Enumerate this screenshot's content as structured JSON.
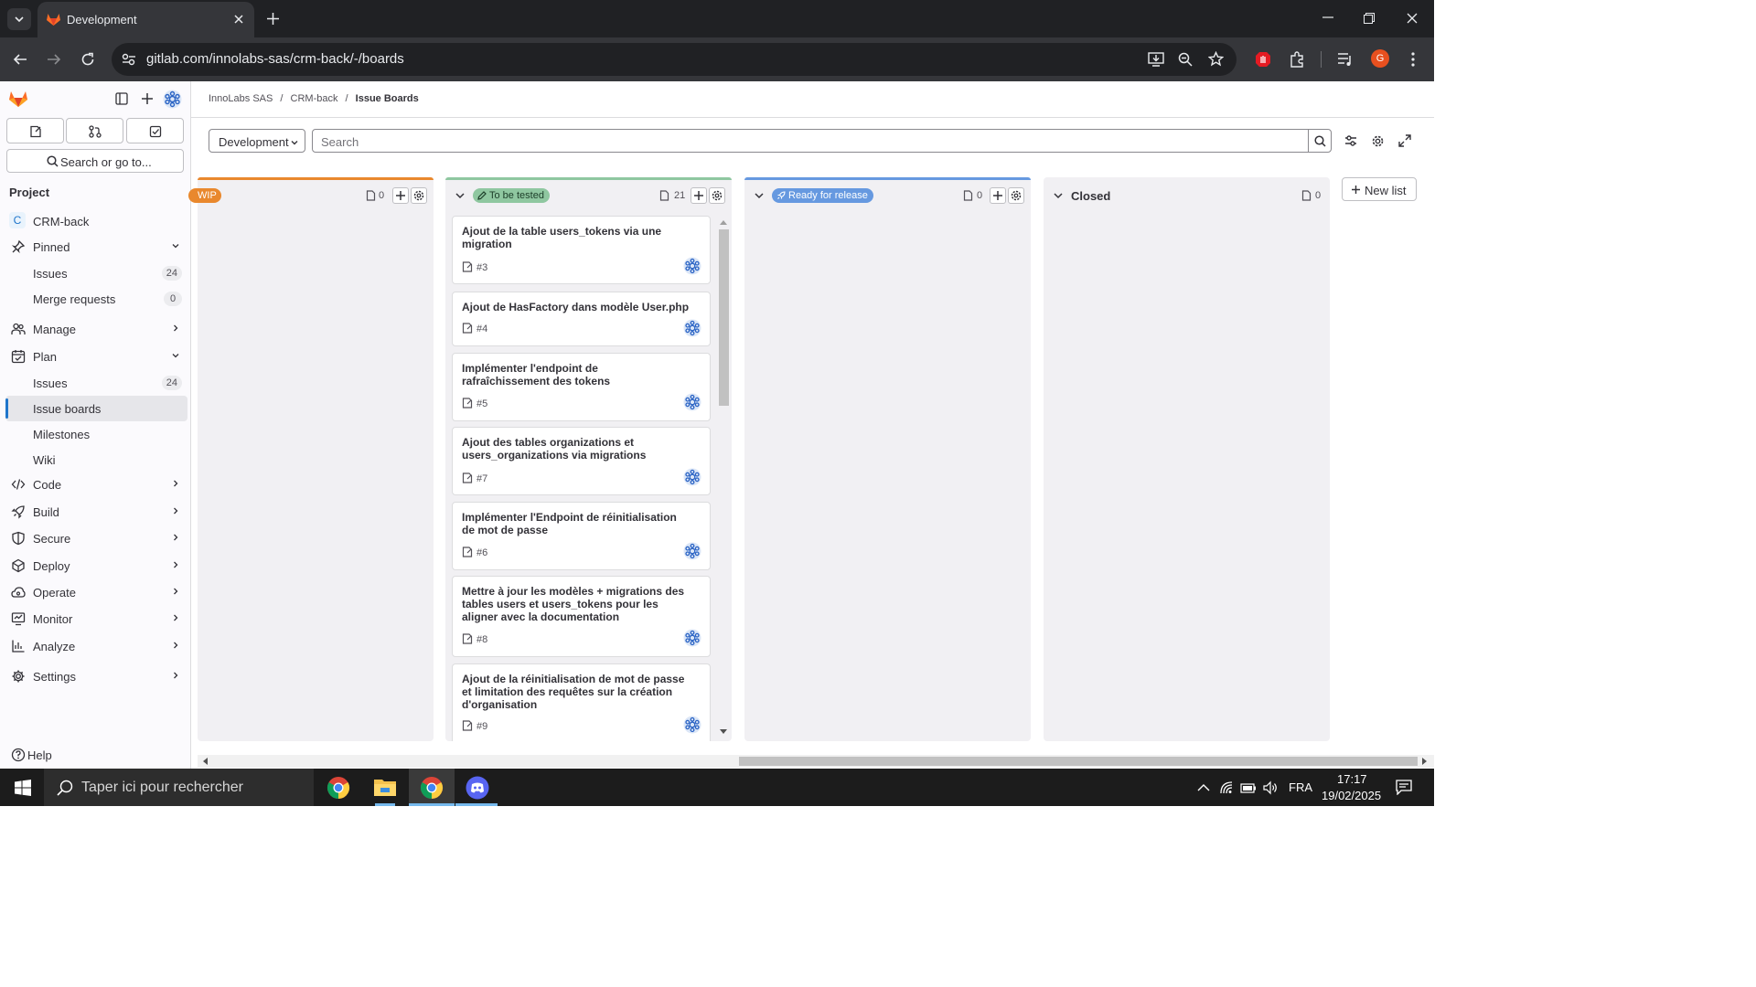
{
  "browser": {
    "tab_title": "Development",
    "url": "gitlab.com/innolabs-sas/crm-back/-/boards",
    "profile_initial": "G"
  },
  "breadcrumb": {
    "group": "InnoLabs SAS",
    "project": "CRM-back",
    "current": "Issue Boards"
  },
  "toolbar": {
    "board_select": "Development",
    "search_placeholder": "Search",
    "new_list": "New list"
  },
  "sidebar": {
    "search": "Search or go to...",
    "section_title": "Project",
    "project_initial": "C",
    "project_name": "CRM-back",
    "pinned": "Pinned",
    "pinned_issues": "Issues",
    "pinned_issues_count": "24",
    "pinned_mrs": "Merge requests",
    "pinned_mrs_count": "0",
    "manage": "Manage",
    "plan": "Plan",
    "plan_issues": "Issues",
    "plan_issues_count": "24",
    "issue_boards": "Issue boards",
    "milestones": "Milestones",
    "wiki": "Wiki",
    "code": "Code",
    "build": "Build",
    "secure": "Secure",
    "deploy": "Deploy",
    "operate": "Operate",
    "monitor": "Monitor",
    "analyze": "Analyze",
    "settings": "Settings",
    "help": "Help"
  },
  "lists": [
    {
      "label": "WIP",
      "count": "0",
      "color": "#e9882d"
    },
    {
      "label": "To be tested",
      "count": "21",
      "color": "#8fc7a0",
      "pill": "#2da160"
    },
    {
      "label": "Ready for release",
      "count": "0",
      "color": "#6699e0",
      "pill": "#5e8fdb"
    },
    {
      "label": "Closed",
      "count": "0"
    }
  ],
  "cards": [
    {
      "title": "Ajout de la table users_tokens via une migration",
      "ref": "#3"
    },
    {
      "title": "Ajout de HasFactory dans modèle User.php",
      "ref": "#4"
    },
    {
      "title": "Implémenter l'endpoint de rafraîchissement des tokens",
      "ref": "#5"
    },
    {
      "title": "Ajout des tables organizations et users_organizations via migrations",
      "ref": "#7"
    },
    {
      "title": "Implémenter l'Endpoint de réinitialisation de mot de passe",
      "ref": "#6"
    },
    {
      "title": "Mettre à jour les modèles + migrations des tables users et users_tokens pour les aligner avec la documentation",
      "ref": "#8"
    },
    {
      "title": "Ajout de la réinitialisation de mot de passe et limitation des requêtes sur la création d'organisation",
      "ref": "#9"
    }
  ],
  "taskbar": {
    "search_placeholder": "Taper ici pour rechercher",
    "lang": "FRA",
    "time": "17:17",
    "date": "19/02/2025"
  }
}
